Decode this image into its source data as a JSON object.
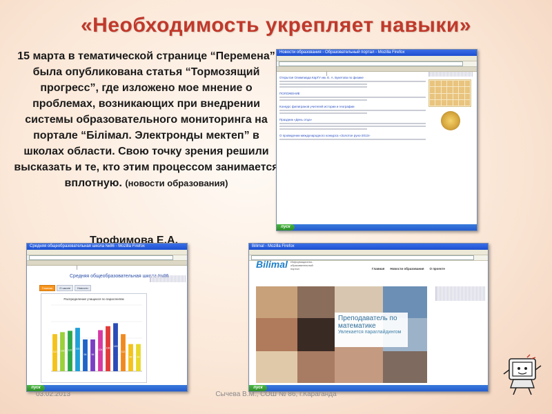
{
  "slide": {
    "title": "«Необходимость укрепляет навыки»",
    "body_main": "15 марта в тематической странице “Перемена” была опубликована статья “Тормозящий прогресс”, где изложено мое мнение о проблемах, возникающих при внедрении системы образовательного мониторинга на портале “Білімал. Электронды мектеп” в школах области. Свою точку зрения решили высказать и те, кто этим процессом занимается вплотную.",
    "body_source": "(новости образования)",
    "author": "Трофимова Е.А.",
    "footer_date": "03.02.2013",
    "footer_author": "Сычева В.М., СОШ № 86, г.Караганда"
  },
  "shot1": {
    "window_title": "Новости образования - Образовательный портал - Mozilla Firefox",
    "news": [
      "Открытая Олимпиада КарГУ им. Е. А. Букетова по физике",
      "ПОЛОЖЕНИЕ",
      "Конкурс филигранов учителей истории и географии",
      "Праздник «День отца»",
      "О проведении международного конкурса «Золотое руно-2013»"
    ],
    "start_label": "пуск"
  },
  "shot2": {
    "window_title": "Средняя общеобразовательная школа №86 - Mozilla Firefox",
    "school_title": "Средняя общеобразовательная школа №86",
    "tabs": [
      "Главная",
      "О школе",
      "Новости"
    ],
    "start_label": "пуск"
  },
  "shot3": {
    "window_title": "Bilimal - Mozilla Firefox",
    "logo": "Bilimal",
    "logo_subtitle": "Информационно-образовательный портал",
    "nav": [
      "Главная",
      "Новости образования",
      "О проекте"
    ],
    "banner_line1": "Преподаватель по математике",
    "banner_line2": "Увлекается параглайдингом",
    "start_label": "пуск"
  },
  "chart_data": {
    "type": "bar",
    "title": "Распределение учащихся по параллелям",
    "values": [
      112,
      118,
      122,
      131,
      96,
      96,
      124,
      136,
      145,
      112,
      82,
      82
    ],
    "colors": [
      "#f4c21a",
      "#9bd13a",
      "#2ea84a",
      "#1fa0d8",
      "#1f64c8",
      "#7a3fc4",
      "#d63aa4",
      "#e23a3a",
      "#2a4bb8",
      "#f08a1e",
      "#f4c21a",
      "#e8d82a"
    ],
    "ylim": [
      0,
      200
    ]
  }
}
